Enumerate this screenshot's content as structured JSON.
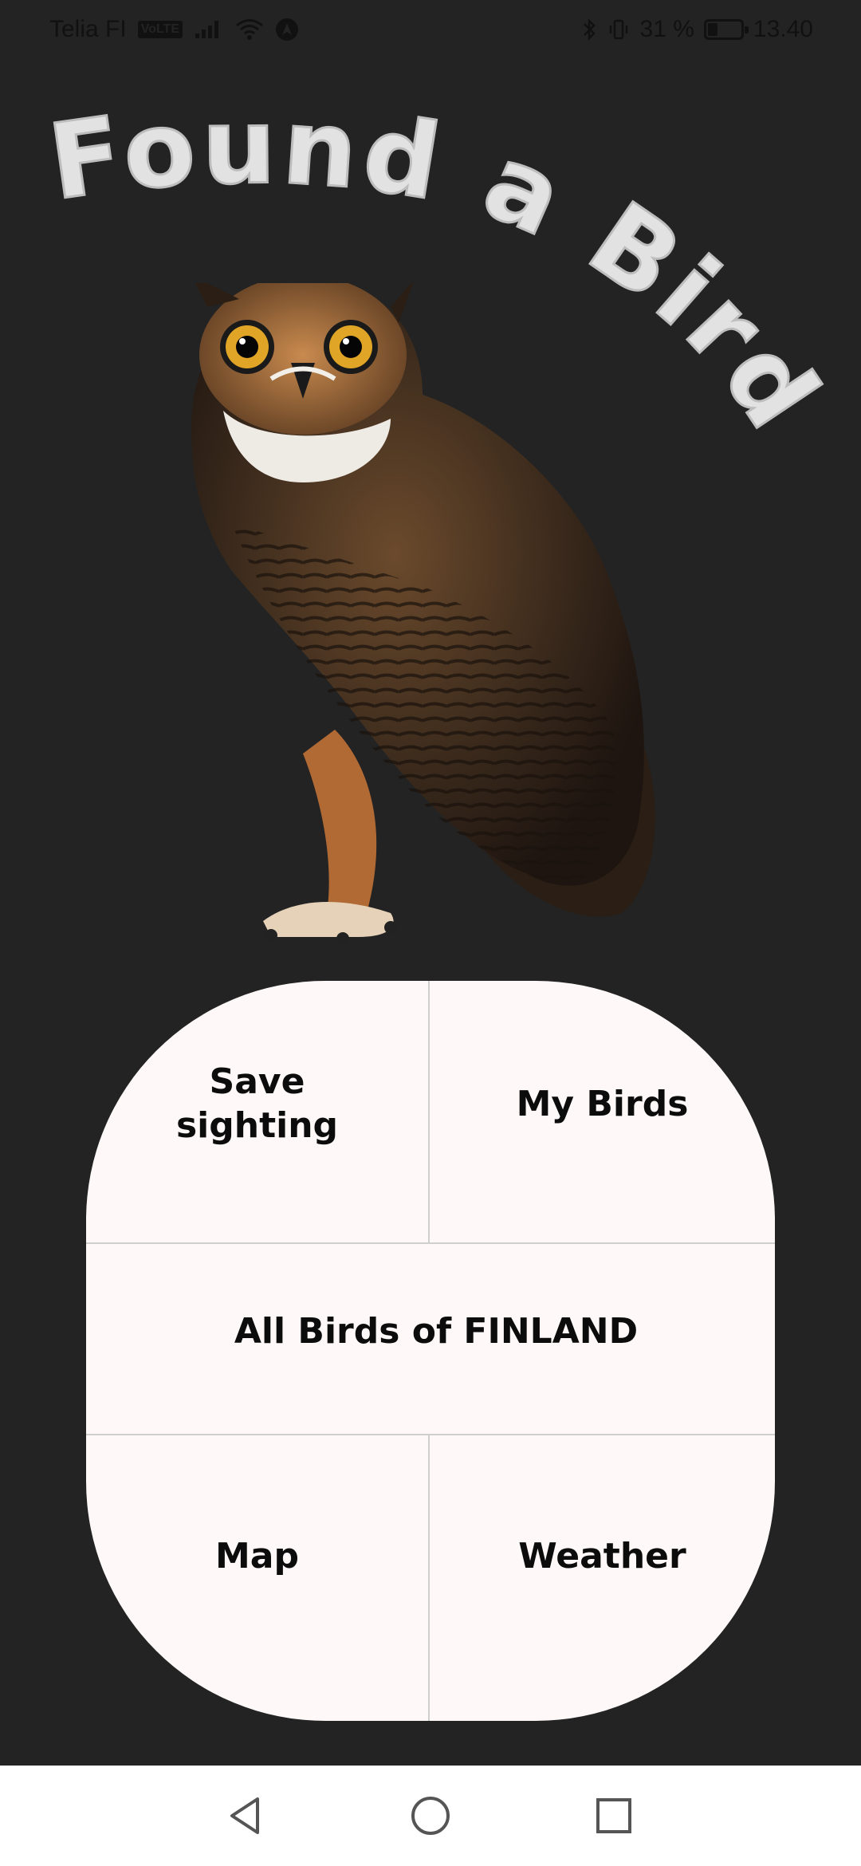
{
  "status_bar": {
    "carrier": "Telia FI",
    "volte": "VoLTE",
    "battery_percent": "31 %",
    "battery_level": 0.31,
    "time": "13.40"
  },
  "app": {
    "title": "Found a Bird"
  },
  "menu": {
    "save_sighting": "Save\nsighting",
    "my_birds": "My Birds",
    "all_birds": "All Birds of FINLAND",
    "map": "Map",
    "weather": "Weather"
  },
  "nav": {
    "back_icon": "triangle-back-icon",
    "home_icon": "circle-home-icon",
    "recents_icon": "square-recents-icon"
  },
  "colors": {
    "background": "#232323",
    "card": "#fef9f8",
    "title": "#e2e2e2"
  }
}
